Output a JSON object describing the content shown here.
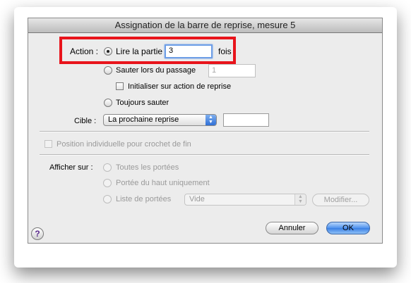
{
  "window": {
    "title": "Assignation de la barre de reprise, mesure 5"
  },
  "action": {
    "label": "Action :",
    "play_label": "Lire la partie",
    "play_count": "3",
    "times_label": "fois",
    "skip_label": "Sauter lors du passage",
    "skip_pass": "1",
    "reset_label": "Initialiser sur action de reprise",
    "always_skip_label": "Toujours sauter"
  },
  "target": {
    "label": "Cible :",
    "selected": "La prochaine reprise",
    "value": ""
  },
  "individual_end_bracket_label": "Position individuelle pour crochet de fin",
  "display": {
    "label": "Afficher sur :",
    "all_staves_label": "Toutes les portées",
    "top_staff_label": "Portée du haut uniquement",
    "staff_list_label": "Liste de portées",
    "staff_list_selected": "Vide",
    "modify_label": "Modifier..."
  },
  "buttons": {
    "cancel": "Annuler",
    "ok": "OK"
  },
  "help_glyph": "?",
  "colors": {
    "highlight": "#e8141b",
    "accent": "#3a7fe4"
  }
}
